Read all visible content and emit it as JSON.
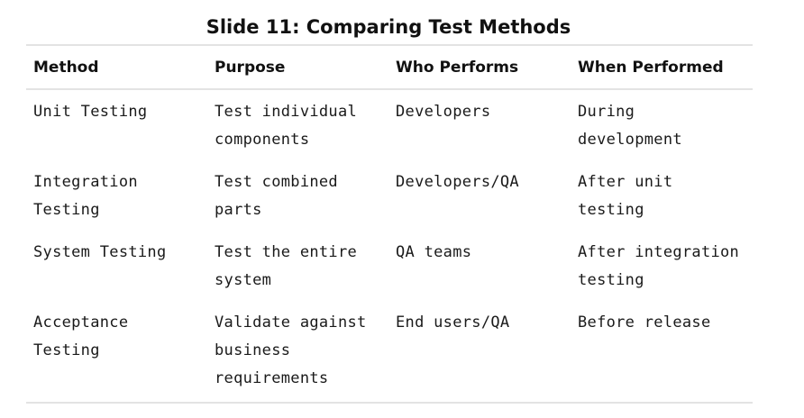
{
  "slide": {
    "title": "Slide 11: Comparing Test Methods"
  },
  "table": {
    "headers": [
      "Method",
      "Purpose",
      "Who Performs",
      "When Performed"
    ],
    "rows": [
      [
        "Unit Testing",
        "Test individual components",
        "Developers",
        "During development"
      ],
      [
        "Integration Testing",
        "Test combined parts",
        "Developers/QA",
        "After unit testing"
      ],
      [
        "System Testing",
        "Test the entire system",
        "QA teams",
        "After integration testing"
      ],
      [
        "Acceptance Testing",
        "Validate against business requirements",
        "End users/QA",
        "Before release"
      ]
    ]
  }
}
